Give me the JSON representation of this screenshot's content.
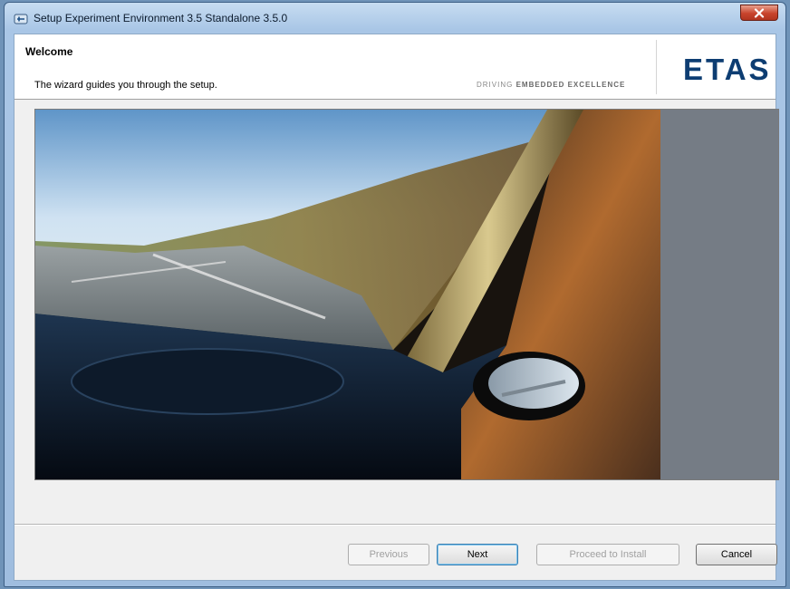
{
  "window": {
    "title": "Setup Experiment Environment 3.5 Standalone 3.5.0"
  },
  "header": {
    "title": "Welcome",
    "subtitle": "The wizard guides you through the setup.",
    "tagline_light": "DRIVING ",
    "tagline_bold": "EMBEDDED EXCELLENCE",
    "logo": "ETAS"
  },
  "buttons": {
    "previous": "Previous",
    "next": "Next",
    "proceed": "Proceed to Install",
    "cancel": "Cancel"
  },
  "colors": {
    "brand": "#0d3d72",
    "title_bar": "#a9c6e6",
    "close_button": "#c8442c"
  },
  "icons": {
    "app": "setup-app-icon",
    "close": "close-icon"
  }
}
